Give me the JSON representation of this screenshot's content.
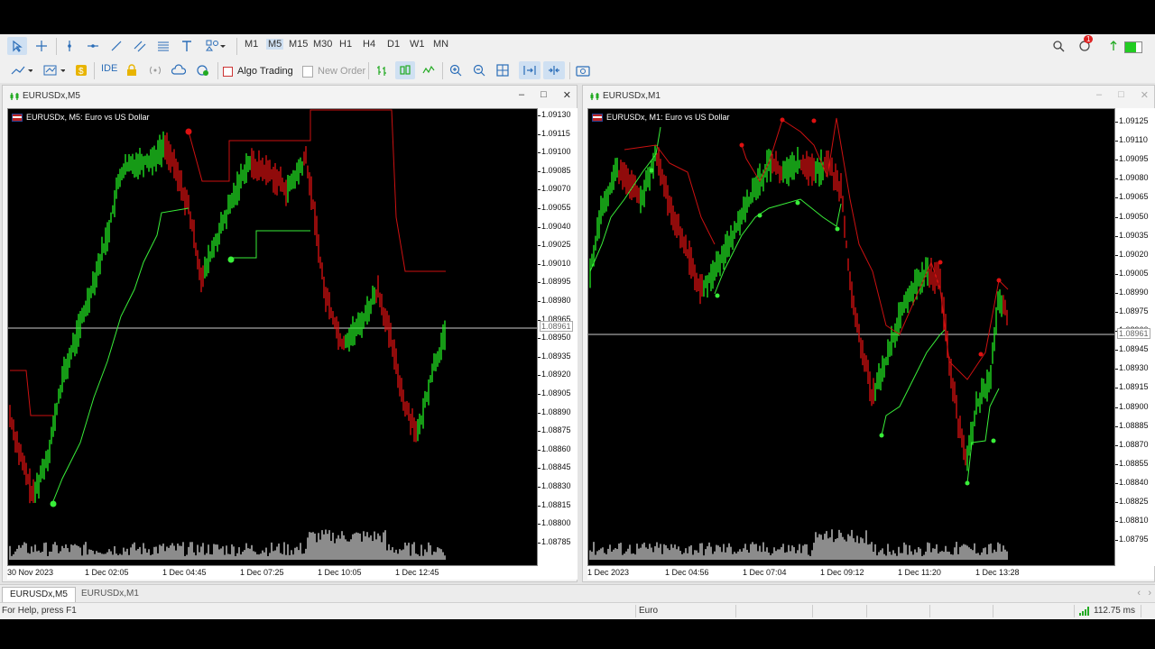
{
  "toolbar": {
    "timeframes": [
      "M1",
      "M5",
      "M15",
      "M30",
      "H1",
      "H4",
      "D1",
      "W1",
      "MN"
    ],
    "selected_timeframe": "M5",
    "algo_trading_label": "Algo Trading",
    "new_order_label": "New Order",
    "ide_label": "IDE",
    "notification_count": "1"
  },
  "windows": [
    {
      "title": "EURUSDx,M5",
      "chart_title": "EURUSDx, M5:  Euro vs US Dollar",
      "price_labels": [
        "1.09130",
        "1.09115",
        "1.09100",
        "1.09085",
        "1.09070",
        "1.09055",
        "1.09040",
        "1.09025",
        "1.09010",
        "1.08995",
        "1.08980",
        "1.08965",
        "1.08950",
        "1.08935",
        "1.08920",
        "1.08905",
        "1.08890",
        "1.08875",
        "1.08860",
        "1.08845",
        "1.08830",
        "1.08815",
        "1.08800",
        "1.08785"
      ],
      "current_price": "1.08961",
      "time_labels": [
        "30 Nov 2023",
        "1 Dec 02:05",
        "1 Dec 04:45",
        "1 Dec 07:25",
        "1 Dec 10:05",
        "1 Dec 12:45"
      ]
    },
    {
      "title": "EURUSDx,M1",
      "chart_title": "EURUSDx, M1:  Euro vs US Dollar",
      "price_labels": [
        "1.09125",
        "1.09110",
        "1.09095",
        "1.09080",
        "1.09065",
        "1.09050",
        "1.09035",
        "1.09020",
        "1.09005",
        "1.08990",
        "1.08975",
        "1.08960",
        "1.08945",
        "1.08930",
        "1.08915",
        "1.08900",
        "1.08885",
        "1.08870",
        "1.08855",
        "1.08840",
        "1.08825",
        "1.08810",
        "1.08795"
      ],
      "current_price": "1.08961",
      "time_labels": [
        "1 Dec 2023",
        "1 Dec 04:56",
        "1 Dec 07:04",
        "1 Dec 09:12",
        "1 Dec 11:20",
        "1 Dec 13:28"
      ]
    }
  ],
  "tabs": [
    "EURUSDx,M5",
    "EURUSDx,M1"
  ],
  "status": {
    "help": "For Help, press F1",
    "symbol": "Euro",
    "ping": "112.75 ms"
  },
  "colors": {
    "bull": "#22ee22",
    "bear": "#dd1111",
    "background": "#000000",
    "bid_line": "#cccccc"
  }
}
